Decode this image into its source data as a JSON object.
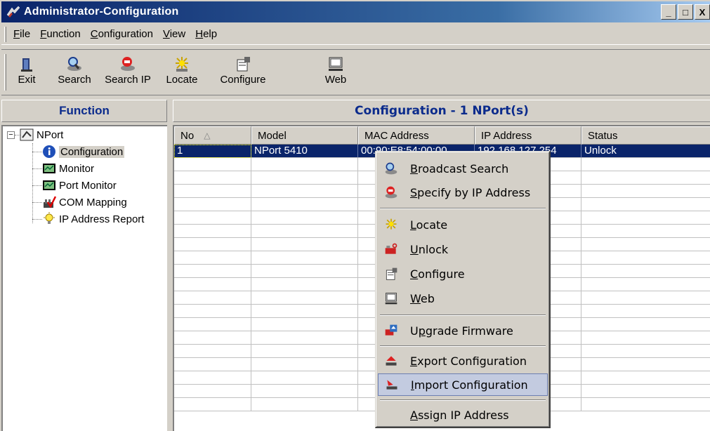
{
  "window": {
    "title": "Administrator-Configuration",
    "controls": [
      "_",
      "□",
      "X"
    ]
  },
  "menubar": [
    {
      "underline": "F",
      "rest": "ile"
    },
    {
      "underline": "F",
      "rest": "unction"
    },
    {
      "underline": "C",
      "rest": "onfiguration"
    },
    {
      "underline": "V",
      "rest": "iew"
    },
    {
      "underline": "H",
      "rest": "elp"
    }
  ],
  "toolbar": [
    {
      "label": "Exit",
      "icon": "exit-icon"
    },
    {
      "label": "Search",
      "icon": "search-icon"
    },
    {
      "label": "Search IP",
      "icon": "search-ip-icon"
    },
    {
      "label": "Locate",
      "icon": "locate-icon"
    },
    {
      "label": "Configure",
      "icon": "configure-icon"
    },
    {
      "label": "Web",
      "icon": "web-icon"
    }
  ],
  "left_panel": {
    "header": "Function",
    "tree": {
      "root": "NPort",
      "children": [
        "Configuration",
        "Monitor",
        "Port Monitor",
        "COM Mapping",
        "IP Address Report"
      ],
      "selected": "Configuration"
    }
  },
  "right_panel": {
    "header": "Configuration - 1 NPort(s)",
    "columns": [
      "No",
      "Model",
      "MAC Address",
      "IP Address",
      "Status"
    ],
    "sort_column": "No",
    "rows": [
      {
        "no": "1",
        "model": "NPort 5410",
        "mac": "00:90:E8:54:00:00",
        "ip": "192.168.127.254",
        "status": "Unlock",
        "selected": true
      }
    ]
  },
  "context_menu": {
    "items": [
      {
        "underline": "B",
        "rest": "roadcast Search",
        "icon": "broadcast-search-icon"
      },
      {
        "underline": "S",
        "rest": "pecify by IP Address",
        "icon": "specify-ip-icon"
      },
      {
        "separator": true
      },
      {
        "underline": "L",
        "rest": "ocate",
        "icon": "locate-icon"
      },
      {
        "underline": "U",
        "rest": "nlock",
        "icon": "unlock-icon"
      },
      {
        "underline": "C",
        "rest": "onfigure",
        "icon": "configure-icon"
      },
      {
        "underline": "W",
        "rest": "eb",
        "icon": "web-icon"
      },
      {
        "separator": true
      },
      {
        "prefix": "U",
        "underline": "p",
        "rest": "grade Firmware",
        "icon": "upgrade-firmware-icon"
      },
      {
        "separator": true
      },
      {
        "underline": "E",
        "rest": "xport Configuration",
        "icon": "export-config-icon"
      },
      {
        "underline": "I",
        "rest": "mport Configuration",
        "icon": "import-config-icon",
        "highlighted": true
      },
      {
        "separator": true
      },
      {
        "underline": "A",
        "rest": "ssign IP Address",
        "icon": ""
      }
    ]
  },
  "colors": {
    "titlebar": "#0a246a",
    "panel_header_text": "#0b2b8c",
    "selection": "#0a246a",
    "menu_highlight": "#c3cbe0"
  }
}
